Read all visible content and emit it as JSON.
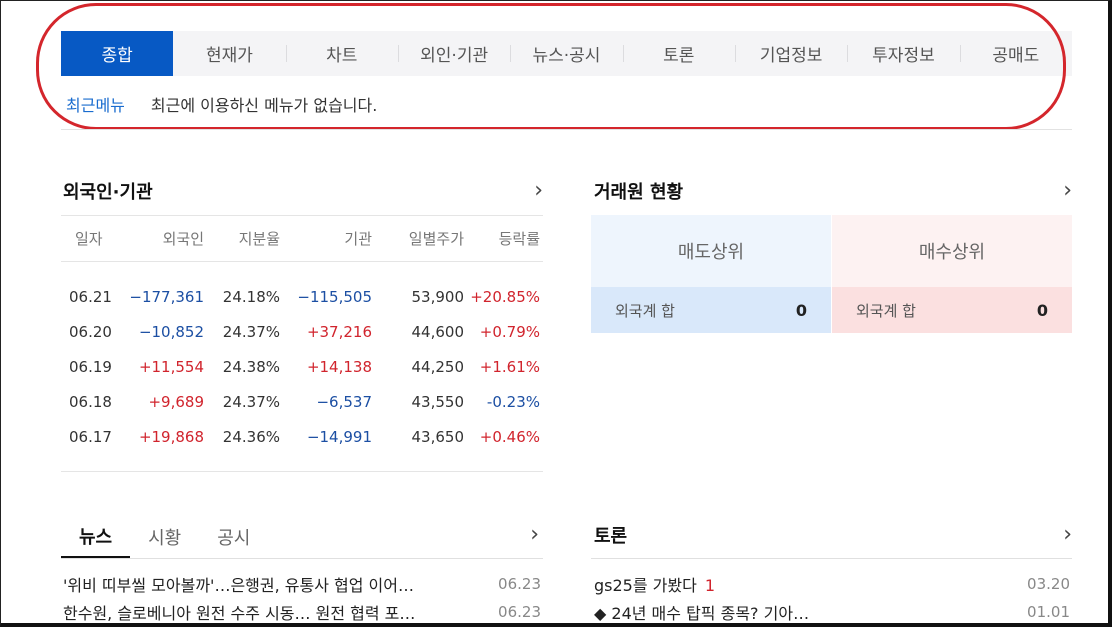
{
  "tabs": [
    "종합",
    "현재가",
    "차트",
    "외인·기관",
    "뉴스·공시",
    "토론",
    "기업정보",
    "투자정보",
    "공매도"
  ],
  "recent": {
    "label": "최근메뉴",
    "message": "최근에 이용하신 메뉴가 없습니다."
  },
  "foreign": {
    "title": "외국인·기관",
    "headers": [
      "일자",
      "외국인",
      "지분율",
      "기관",
      "일별주가",
      "등락률"
    ],
    "rows": [
      [
        "06.21",
        "−177,361",
        "24.18%",
        "−115,505",
        "53,900",
        "+20.85%"
      ],
      [
        "06.20",
        "−10,852",
        "24.37%",
        "+37,216",
        "44,600",
        "+0.79%"
      ],
      [
        "06.19",
        "+11,554",
        "24.38%",
        "+14,138",
        "44,250",
        "+1.61%"
      ],
      [
        "06.18",
        "+9,689",
        "24.37%",
        "−6,537",
        "43,550",
        "-0.23%"
      ],
      [
        "06.17",
        "+19,868",
        "24.36%",
        "−14,991",
        "43,650",
        "+0.46%"
      ]
    ]
  },
  "broker": {
    "title": "거래원 현황",
    "sell_label": "매도상위",
    "buy_label": "매수상위",
    "sell_sum_label": "외국계 합",
    "sell_sum_value": "0",
    "buy_sum_label": "외국계 합",
    "buy_sum_value": "0"
  },
  "news": {
    "tabs": [
      "뉴스",
      "시황",
      "공시"
    ],
    "items": [
      {
        "title": "'위비 띠부씰 모아볼까'…은행권, 유통사 협업 이어…",
        "date": "06.23"
      },
      {
        "title": "한수원, 슬로베니아 원전 수주 시동… 원전 협력 포…",
        "date": "06.23"
      }
    ]
  },
  "toron": {
    "title": "토론",
    "items": [
      {
        "title": "gs25를 가봤다",
        "comments": "1",
        "date": "03.20"
      },
      {
        "title": "◆ 24년 매수 탑픽 종목? 기아…",
        "comments": "",
        "date": "01.01"
      }
    ]
  },
  "chevron": "›",
  "colors": {
    "active_tab": "#0759c4",
    "up": "#d1242d",
    "down": "#1c4fa3",
    "annotation": "#d4262c"
  }
}
